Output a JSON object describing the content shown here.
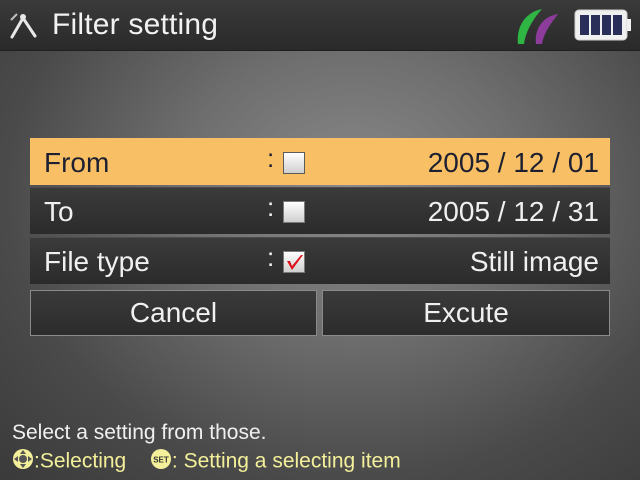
{
  "header": {
    "title": "Filter setting",
    "tool_icon": "filter-tool-icon",
    "mode_icon": "leaf-icon",
    "battery_icon": "battery-full-icon",
    "battery_level": 1.0
  },
  "rows": [
    {
      "label": "From",
      "separator": ":",
      "checked": false,
      "value": "2005 / 12 / 01",
      "selected": true
    },
    {
      "label": "To",
      "separator": ":",
      "checked": false,
      "value": "2005 / 12 / 31",
      "selected": false
    },
    {
      "label": "File type",
      "separator": ":",
      "checked": true,
      "value": "Still image",
      "selected": false
    }
  ],
  "buttons": {
    "cancel": "Cancel",
    "execute": "Excute"
  },
  "help": {
    "line1": "Select a setting from those.",
    "dpad_text": ":Selecting",
    "set_key": "SET",
    "set_text": ": Setting a selecting item"
  },
  "colors": {
    "selected_row": "#f9bf64",
    "check_mark": "#e0101a",
    "help_accent": "#f4ef9a",
    "leaf_green": "#2fb544",
    "leaf_purple": "#8e3c9c"
  }
}
